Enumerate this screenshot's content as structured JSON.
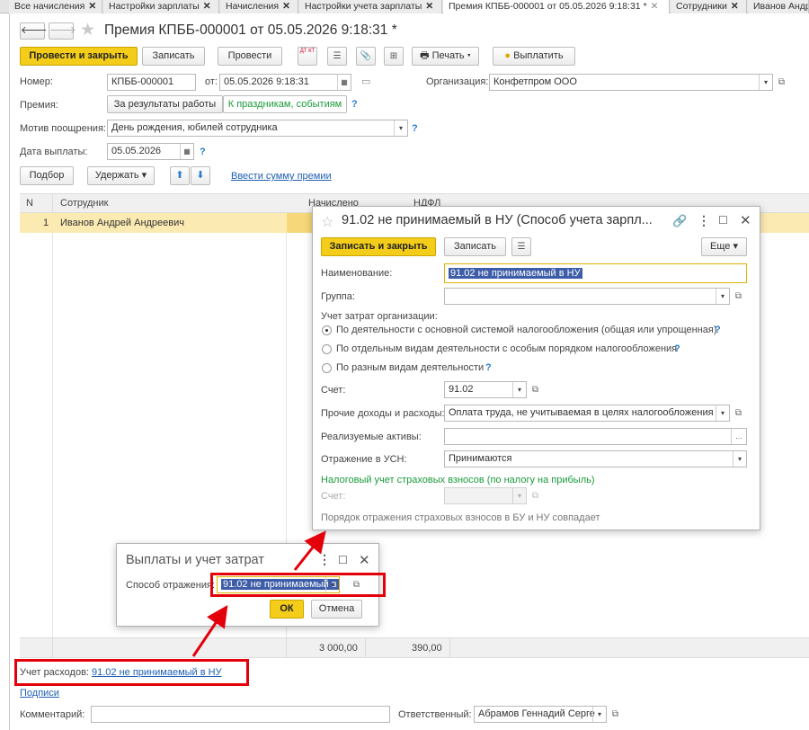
{
  "tabs": [
    {
      "label": "Все начисления"
    },
    {
      "label": "Настройки зарплаты"
    },
    {
      "label": "Начисления"
    },
    {
      "label": "Настройки учета зарплаты"
    },
    {
      "label": "Премия КПББ-000001 от 05.05.2026 9:18:31 *"
    },
    {
      "label": "Сотрудники"
    },
    {
      "label": "Иванов Андр"
    }
  ],
  "doc": {
    "title": "Премия КПББ-000001 от 05.05.2026 9:18:31 *",
    "toolbar": {
      "post_close": "Провести и закрыть",
      "save": "Записать",
      "post": "Провести",
      "dtkt": "ДТ КТ",
      "print": "Печать",
      "pay": "Выплатить"
    },
    "number_label": "Номер:",
    "number_value": "КПББ-000001",
    "date_from_label": "от:",
    "date_value": "05.05.2026  9:18:31",
    "org_label": "Организация:",
    "org_value": "Конфетпром ООО",
    "premium_label": "Премия:",
    "premium_btn1": "За результаты работы",
    "premium_btn2": "К праздникам, событиям",
    "motive_label": "Мотив поощрения:",
    "motive_value": "День рождения, юбилей сотрудника",
    "paydate_label": "Дата выплаты:",
    "paydate_value": "05.05.2026",
    "pick_btn": "Подбор",
    "hold_btn": "Удержать",
    "enter_sum_link": "Ввести сумму премии",
    "table": {
      "headers": [
        "N",
        "Сотрудник",
        "Начислено",
        "НДФЛ"
      ],
      "rows": [
        {
          "n": "1",
          "employee": "Иванов Андрей Андреевич"
        }
      ],
      "total_accrued": "3 000,00",
      "total_ndfl": "390,00"
    },
    "expense_label": "Учет расходов:",
    "expense_link": "91.02 не принимаемый в НУ",
    "signatures_link": "Подписи",
    "comment_label": "Комментарий:",
    "responsible_label": "Ответственный:",
    "responsible_value": "Абрамов Геннадий Серге"
  },
  "payments_dialog": {
    "title": "Выплаты и учет затрат",
    "method_label": "Способ отражения:",
    "method_value": "91.02 не принимаемый в",
    "ok": "ОК",
    "cancel": "Отмена"
  },
  "method_dialog": {
    "title": "91.02 не принимаемый в НУ (Способ учета зарпл...",
    "save_close": "Записать и закрыть",
    "save": "Записать",
    "more": "Еще",
    "name_label": "Наименование:",
    "name_value": "91.02 не принимаемый в НУ",
    "group_label": "Группа:",
    "costs_label": "Учет затрат организации:",
    "radios": [
      "По деятельности с основной системой налогообложения (общая или упрощенная)",
      "По отдельным видам деятельности с особым порядком налогообложения",
      "По разным видам деятельности"
    ],
    "account_label": "Счет:",
    "account_value": "91.02",
    "other_label": "Прочие доходы и расходы:",
    "other_value": "Оплата труда, не учитываемая в целях налогообложения",
    "assets_label": "Реализуемые активы:",
    "usn_label": "Отражение в УСН:",
    "usn_value": "Принимаются",
    "tax_section": "Налоговый учет страховых взносов (по налогу на прибыль)",
    "tax_account_label": "Счет:",
    "note": "Порядок отражения страховых взносов в БУ и НУ совпадает"
  },
  "colors": {
    "accent_yellow": "#f3cd1a",
    "link": "#1e5fb3",
    "green": "#1a9a3a",
    "highlight_red": "#e3000b",
    "selection": "#3d5da8"
  }
}
